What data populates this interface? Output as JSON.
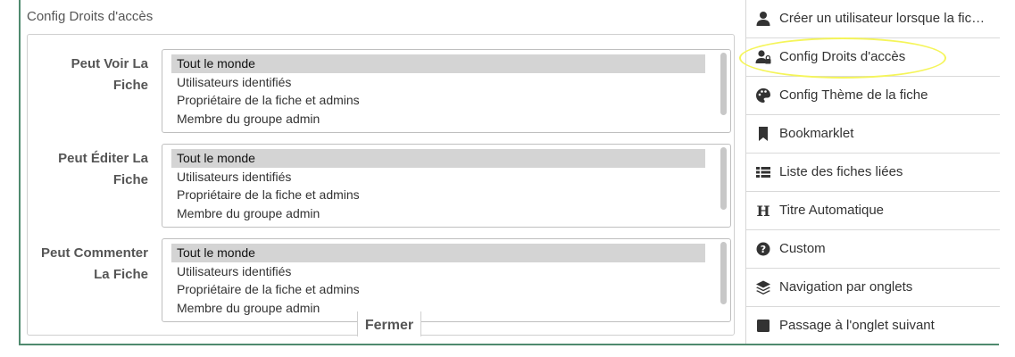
{
  "panel": {
    "title": "Config Droits d'accès",
    "close_label": "Fermer"
  },
  "fields": [
    {
      "label_line1": "Peut Voir La",
      "label_line2": "Fiche",
      "options": [
        "Tout le monde",
        "Utilisateurs identifiés",
        "Propriétaire de la fiche et admins",
        "Membre du groupe admin"
      ],
      "selected": "Tout le monde"
    },
    {
      "label_line1": "Peut Éditer La",
      "label_line2": "Fiche",
      "options": [
        "Tout le monde",
        "Utilisateurs identifiés",
        "Propriétaire de la fiche et admins",
        "Membre du groupe admin"
      ],
      "selected": "Tout le monde"
    },
    {
      "label_line1": "Peut Commenter",
      "label_line2": "La Fiche",
      "options": [
        "Tout le monde",
        "Utilisateurs identifiés",
        "Propriétaire de la fiche et admins",
        "Membre du groupe admin"
      ],
      "selected": "Tout le monde"
    }
  ],
  "menu": {
    "items": [
      {
        "label": "Créer un utilisateur lorsque la fic…",
        "icon": "user-icon"
      },
      {
        "label": "Config Droits d'accès",
        "icon": "user-lock-icon"
      },
      {
        "label": "Config Thème de la fiche",
        "icon": "palette-icon"
      },
      {
        "label": "Bookmarklet",
        "icon": "bookmark-icon"
      },
      {
        "label": "Liste des fiches liées",
        "icon": "list-icon"
      },
      {
        "label": "Titre Automatique",
        "icon": "heading-icon"
      },
      {
        "label": "Custom",
        "icon": "question-circle-icon"
      },
      {
        "label": "Navigation par onglets",
        "icon": "layers-icon"
      },
      {
        "label": "Passage à l'onglet suivant",
        "icon": "square-icon"
      }
    ]
  },
  "colors": {
    "frame": "#4f8a6e",
    "highlight": "#f5f55a",
    "selected_option": "#d4d4d4"
  }
}
